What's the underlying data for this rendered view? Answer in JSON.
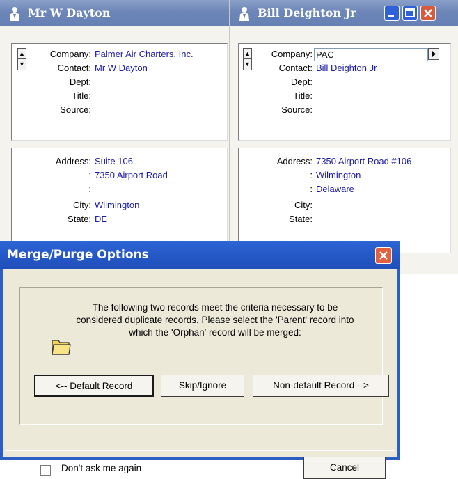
{
  "windows": [
    {
      "title": "Mr  W Dayton",
      "fields_top": [
        {
          "label": "Company:",
          "value": "Palmer Air Charters, Inc."
        },
        {
          "label": "Contact:",
          "value": "Mr  W Dayton"
        },
        {
          "label": "Dept:",
          "value": ""
        },
        {
          "label": "Title:",
          "value": ""
        },
        {
          "label": "Source:",
          "value": ""
        }
      ],
      "fields_bottom": [
        {
          "label": "Address:",
          "value": "Suite 106"
        },
        {
          "label": ":",
          "value": "7350 Airport Road"
        },
        {
          "label": ":",
          "value": ""
        },
        {
          "label": "City:",
          "value": "Wilmington"
        },
        {
          "label": "State:",
          "value": "DE"
        }
      ]
    },
    {
      "title": "Bill Deighton Jr",
      "company_input": "PAC",
      "fields_top": [
        {
          "label": "Company:",
          "value": ""
        },
        {
          "label": "Contact:",
          "value": "Bill Deighton Jr"
        },
        {
          "label": "Dept:",
          "value": ""
        },
        {
          "label": "Title:",
          "value": ""
        },
        {
          "label": "Source:",
          "value": ""
        }
      ],
      "fields_bottom": [
        {
          "label": "Address:",
          "value": "7350 Airport Road #106"
        },
        {
          "label": ":",
          "value": "Wilmington"
        },
        {
          "label": ":",
          "value": "Delaware"
        },
        {
          "label": "City:",
          "value": ""
        },
        {
          "label": "State:",
          "value": ""
        }
      ]
    }
  ],
  "dialog": {
    "title": "Merge/Purge Options",
    "message": "The following two records meet the criteria necessary to be considered duplicate records.  Please select the 'Parent' record into which the 'Orphan' record will be merged:",
    "buttons": {
      "default_record": "<-- Default Record",
      "skip": "Skip/Ignore",
      "non_default_record": "Non-default Record -->",
      "cancel": "Cancel"
    },
    "checkbox_label": "Don't ask me again"
  },
  "colors": {
    "title_bar": "#6d86b8",
    "dialog_title_bar": "#2457c5",
    "field_value": "#1a1aa6",
    "close_button": "#e2603e"
  }
}
